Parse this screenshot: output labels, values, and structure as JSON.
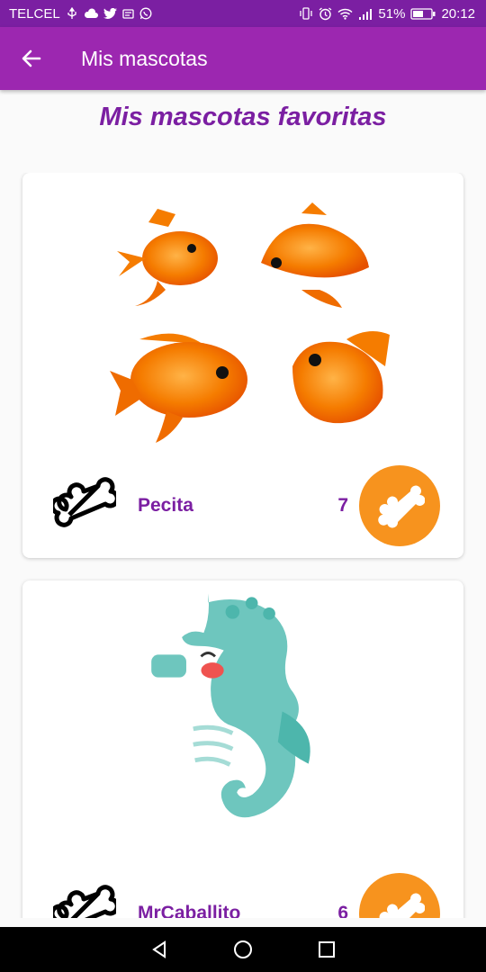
{
  "status": {
    "carrier": "TELCEL",
    "notif_icons": [
      "usb-icon",
      "cloud-icon",
      "twitter-icon",
      "message-icon",
      "whatsapp-icon"
    ],
    "battery": "51%",
    "time": "20:12"
  },
  "appbar": {
    "title": "Mis mascotas"
  },
  "page": {
    "heading": "Mis mascotas favoritas"
  },
  "pets": [
    {
      "name": "Pecita",
      "count": "7",
      "image": "goldfish-group-illustration"
    },
    {
      "name": "MrCaballito",
      "count": "6",
      "image": "seahorse-illustration"
    }
  ],
  "colors": {
    "primary": "#9c27b0",
    "primary_dark": "#7b1fa2",
    "accent": "#f7931e",
    "text": "#7b1fa2"
  }
}
